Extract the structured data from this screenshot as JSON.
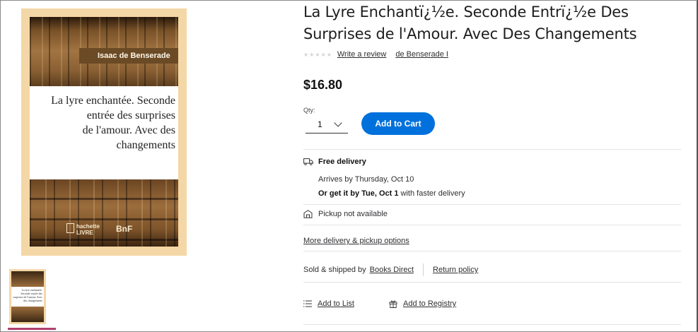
{
  "product": {
    "title": "La Lyre Enchantï¿½e. Seconde Entrï¿½e Des Surprises de l'Amour. Avec Des Changements",
    "author_link": "de Benserade I",
    "write_review": "Write a review",
    "stars": "★★★★★",
    "price": "$16.80"
  },
  "cover": {
    "author": "Isaac de Benserade",
    "title": "La lyre enchantée. Seconde\nentrée des surprises\nde l'amour. Avec des\nchangements",
    "publisher": "hachette\nLIVRE",
    "bnf": "BnF"
  },
  "thumbnail": {
    "title": "La lyre enchantée. Seconde entrée des surprises de l'amour. Avec des changements"
  },
  "quantity": {
    "label": "Qty:",
    "value": "1"
  },
  "buttons": {
    "add_to_cart": "Add to Cart"
  },
  "delivery": {
    "heading": "Free delivery",
    "arrives": "Arrives by Thursday, Oct 10",
    "faster_prefix": "Or get it by Tue, Oct 1",
    "faster_suffix": " with faster delivery",
    "pickup": "Pickup not available",
    "more_options": "More delivery & pickup options"
  },
  "seller": {
    "label": "Sold & shipped by",
    "name": "Books Direct",
    "return_policy": "Return policy"
  },
  "actions": {
    "add_to_list": "Add to List",
    "add_to_registry": "Add to Registry"
  },
  "colors": {
    "primary_button": "#0071dc",
    "thumb_selected": "#b0406e"
  }
}
